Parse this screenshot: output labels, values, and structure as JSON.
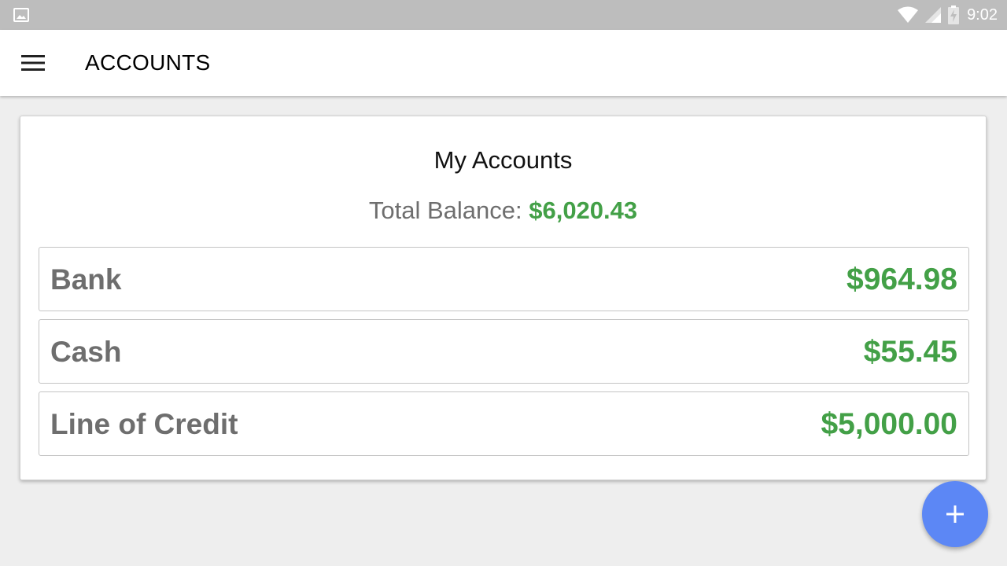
{
  "status_bar": {
    "time": "9:02",
    "icons": [
      "image-icon",
      "wifi-icon",
      "signal-icon",
      "battery-charging-icon"
    ]
  },
  "app_bar": {
    "title": "ACCOUNTS",
    "menu_icon": "hamburger-menu-icon"
  },
  "card": {
    "title": "My Accounts",
    "total_label": "Total Balance:",
    "total_value": "$6,020.43"
  },
  "accounts": [
    {
      "name": "Bank",
      "amount": "$964.98"
    },
    {
      "name": "Cash",
      "amount": "$55.45"
    },
    {
      "name": "Line of Credit",
      "amount": "$5,000.00"
    }
  ],
  "fab": {
    "icon": "plus-icon"
  },
  "colors": {
    "accent_green": "#43a047",
    "fab_blue": "#5c87f5",
    "status_bar_gray": "#bdbdbd",
    "label_gray": "#6e6e6e"
  }
}
